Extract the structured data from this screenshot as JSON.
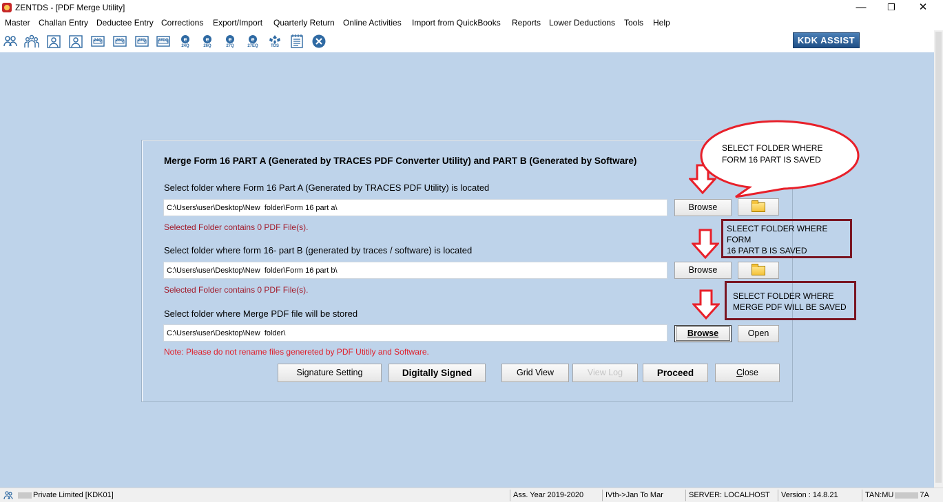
{
  "window": {
    "title": "ZENTDS - [PDF Merge Utility]",
    "minimize": "—",
    "maximize": "❐",
    "close": "✕"
  },
  "menu": [
    "Master",
    "Challan Entry",
    "Deductee Entry",
    "Corrections",
    "Export/Import",
    "Quarterly Return",
    "Online Activities",
    "Import from QuickBooks",
    "Reports",
    "Lower Deductions",
    "Tools",
    "Help"
  ],
  "toolbar": {
    "icons": [
      "users-icon",
      "group-icon",
      "person-card-icon",
      "person-card-2-icon",
      "form-24q-icon",
      "form-26q-icon",
      "form-27q-icon",
      "form-27eq-icon",
      "e-24q-icon",
      "e-26q-icon",
      "e-27q-icon",
      "e-27eq-icon",
      "tds-icon",
      "notepad-icon",
      "exit-icon"
    ],
    "badges": [
      "",
      "",
      "",
      "",
      "24Q",
      "26Q",
      "27Q",
      "27EQ",
      "24Q",
      "26Q",
      "27Q",
      "27EQ",
      "TDS",
      "",
      ""
    ],
    "kdk_assist": "KDK ASSIST"
  },
  "form": {
    "heading": "Merge Form 16 PART A (Generated by TRACES PDF Converter Utility) and PART B (Generated by Software)",
    "part_a": {
      "label": "Select folder where Form 16 Part A (Generated by TRACES PDF Utility) is located",
      "path": "C:\\Users\\user\\Desktop\\New  folder\\Form 16 part a\\",
      "status": "Selected Folder contains 0 PDF File(s).",
      "browse": "Browse"
    },
    "part_b": {
      "label": "Select folder where form 16- part B (generated by traces / software) is located",
      "path": "C:\\Users\\user\\Desktop\\New  folder\\Form 16 part b\\",
      "status": "Selected Folder contains 0 PDF File(s).",
      "browse": "Browse"
    },
    "output": {
      "label": "Select folder where Merge PDF file will be stored",
      "path": "C:\\Users\\user\\Desktop\\New  folder\\",
      "browse": "Browse",
      "open": "Open"
    },
    "note": "Note: Please do not rename files genereted by PDF Utitily and Software.",
    "buttons": {
      "signature_setting": "Signature Setting",
      "digitally_signed": "Digitally Signed",
      "grid_view": "Grid View",
      "view_log": "View Log",
      "proceed": "Proceed",
      "close_first": "C",
      "close_rest": "lose"
    }
  },
  "annotations": {
    "oval": [
      "SELECT FOLDER WHERE",
      "FORM 16 PART IS SAVED"
    ],
    "box_b": [
      "SLEECT FOLDER WHERE FORM",
      "16 PART B IS SAVED"
    ],
    "box_merge": [
      "SELECT FOLDER WHERE",
      "MERGE PDF WILL BE SAVED"
    ],
    "accent": "#e8202a",
    "box_color": "#7a1522"
  },
  "statusbar": {
    "company": "Private Limited [KDK01]",
    "year": "Ass. Year 2019-2020",
    "quarter": "IVth->Jan To Mar",
    "server": "SERVER: LOCALHOST",
    "version": "Version : 14.8.21",
    "tan_prefix": "TAN:MU",
    "tan_suffix": "7A"
  }
}
